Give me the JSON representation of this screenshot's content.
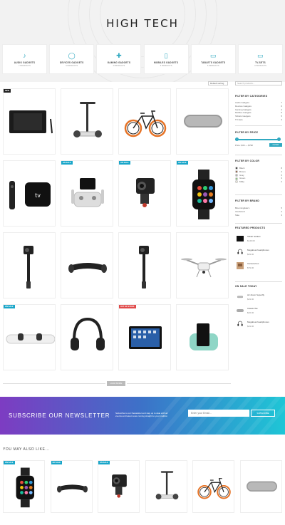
{
  "hero": {
    "title": "HIGH TECH"
  },
  "categories": [
    {
      "name": "AUDIO GADGETS",
      "count": "7 PRODUCTS",
      "icon": "earbuds-icon",
      "glyph": "♪"
    },
    {
      "name": "DEVICES GADGETS",
      "count": "6 PRODUCTS",
      "icon": "mouse-icon",
      "glyph": "◯"
    },
    {
      "name": "GAMING GADGETS",
      "count": "4 PRODUCTS",
      "icon": "gamepad-icon",
      "glyph": "✚"
    },
    {
      "name": "MOBILES GADGETS",
      "count": "5 PRODUCTS",
      "icon": "phone-icon",
      "glyph": "▯"
    },
    {
      "name": "TABLETS GADGETS",
      "count": "5 PRODUCTS",
      "icon": "tablet-icon",
      "glyph": "▭"
    },
    {
      "name": "TV-SETS",
      "count": "3 PRODUCTS",
      "icon": "tv-icon",
      "glyph": "▭"
    }
  ],
  "toolbar": {
    "sort_label": "Default sorting"
  },
  "products": [
    {
      "type": "graphics-tablet",
      "badge": "NEW",
      "badge_color": "#222"
    },
    {
      "type": "segway",
      "badge": "",
      "badge_color": ""
    },
    {
      "type": "bicycle",
      "badge": "",
      "badge_color": ""
    },
    {
      "type": "speaker",
      "badge": "",
      "badge_color": ""
    },
    {
      "type": "apple-tv",
      "badge": "",
      "badge_color": ""
    },
    {
      "type": "drone-controller",
      "badge": "ON SALE",
      "badge_color": "#1aa6c9"
    },
    {
      "type": "action-camera",
      "badge": "ON SALE",
      "badge_color": "#1aa6c9"
    },
    {
      "type": "smartwatch",
      "badge": "ON SALE",
      "badge_color": "#1aa6c9"
    },
    {
      "type": "camera-stick",
      "badge": "",
      "badge_color": ""
    },
    {
      "type": "hoverboard",
      "badge": "",
      "badge_color": ""
    },
    {
      "type": "camera-stick",
      "badge": "",
      "badge_color": ""
    },
    {
      "type": "drone",
      "badge": "",
      "badge_color": ""
    },
    {
      "type": "snowboard",
      "badge": "ON SALE",
      "badge_color": "#1aa6c9"
    },
    {
      "type": "headphones",
      "badge": "",
      "badge_color": ""
    },
    {
      "type": "ipad",
      "badge": "OUT OF STOCK",
      "badge_color": "#e04a4a"
    },
    {
      "type": "phone-dock",
      "badge": "",
      "badge_color": ""
    }
  ],
  "load_more": "LOAD MORE",
  "sidebar": {
    "search_placeholder": "Search products...",
    "categories_title": "FILTER BY CATEGORIES",
    "categories": [
      {
        "name": "Audio Gadgets",
        "count": "7"
      },
      {
        "name": "Devices Gadgets",
        "count": "6"
      },
      {
        "name": "Gaming Gadgets",
        "count": "4"
      },
      {
        "name": "Mobiles Gadgets",
        "count": "5"
      },
      {
        "name": "Tablets Gadgets",
        "count": "5"
      },
      {
        "name": "TV-Sets",
        "count": "3"
      }
    ],
    "price_title": "FILTER BY PRICE",
    "price_range": "Price: $36 — $798",
    "price_button": "FILTER",
    "color_title": "FILTER BY COLOR",
    "colors": [
      {
        "name": "Black",
        "count": "8",
        "color": "#222222"
      },
      {
        "name": "Brown",
        "count": "4",
        "color": "#8a4b2a"
      },
      {
        "name": "Gray",
        "count": "5",
        "color": "#aaaaaa"
      },
      {
        "name": "Green",
        "count": "3",
        "color": "#7ec66e"
      },
      {
        "name": "Milky",
        "count": "2",
        "color": "#f0ebdc"
      }
    ],
    "brand_title": "FILTER BY BRAND",
    "brands": [
      {
        "name": "Bloomingdale's",
        "count": "5"
      },
      {
        "name": "Interbrand",
        "count": "4"
      },
      {
        "name": "Nike",
        "count": "3"
      }
    ],
    "featured_title": "FEATURED PRODUCTS",
    "featured": [
      {
        "name": "Tablet holders",
        "price": "$149.00",
        "type": "tablet"
      },
      {
        "name": "Megabeat headphones",
        "price": "$29.00",
        "type": "headphones"
      },
      {
        "name": "Camera box",
        "price": "$79.00",
        "type": "camera-box"
      }
    ],
    "onsale_title": "ON SALE TODAY",
    "onsale": [
      {
        "name": "Air Zoom Superfly",
        "price": "$29.00",
        "type": "speaker"
      },
      {
        "name": "Classic flat",
        "price": "$26.00",
        "type": "snow"
      },
      {
        "name": "Megabeat headphones",
        "price": "$29.00",
        "type": "headphones"
      }
    ]
  },
  "newsletter": {
    "title": "SUBSCRIBE OUR NEWSLETTER",
    "text": "Subscribe to our Newsletter and stay up to date with all events and latest news coming straight to your mailbox",
    "placeholder": "Enter your Email...",
    "button": "SUBSCRIBE"
  },
  "also_like": {
    "title": "YOU MAY ALSO LIKE...",
    "items": [
      {
        "type": "smartwatch",
        "badge": "ON SALE",
        "badge_color": "#1aa6c9"
      },
      {
        "type": "hoverboard",
        "badge": "ON SALE",
        "badge_color": "#1aa6c9"
      },
      {
        "type": "action-camera",
        "badge": "ON SALE",
        "badge_color": "#1aa6c9"
      },
      {
        "type": "segway",
        "badge": "",
        "badge_color": ""
      },
      {
        "type": "bicycle",
        "badge": "",
        "badge_color": ""
      },
      {
        "type": "speaker",
        "badge": "",
        "badge_color": ""
      }
    ]
  }
}
